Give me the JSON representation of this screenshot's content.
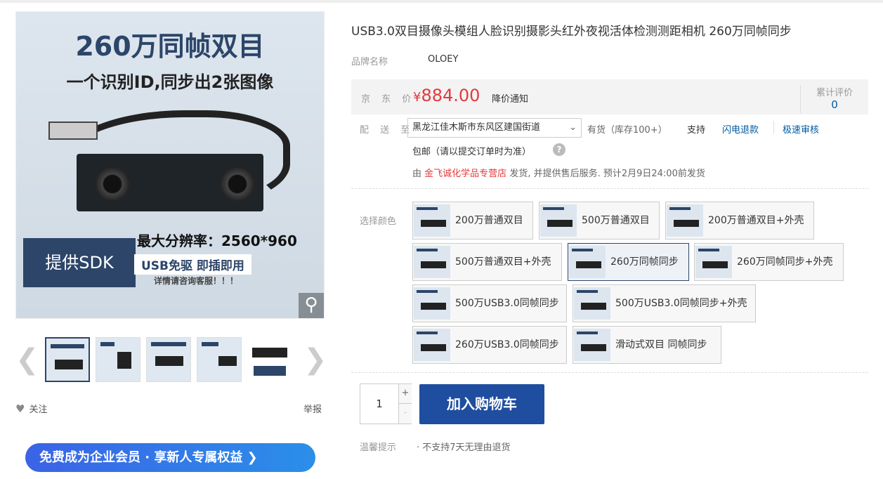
{
  "gallery": {
    "main_image": {
      "headline": "260万同帧双目",
      "subline": "一个识别ID,同步出2张图像",
      "spec": "最大分辨率：2560*960",
      "sdk": "提供SDK",
      "usb": "USB免驱 即插即用",
      "consult": "详情请咨询客服！！！"
    },
    "follow_label": "关注",
    "report_label": "举报"
  },
  "banner": {
    "text": "免费成为企业会员 · 享新人专属权益"
  },
  "product": {
    "title": "USB3.0双目摄像头模组人脸识别摄影头红外夜视活体检测测距相机 260万同帧同步",
    "brand_label": "品牌名称",
    "brand_value": "OLOEY"
  },
  "price": {
    "label": "京 东 价",
    "symbol": "¥",
    "amount": "884.00",
    "notice": "降价通知",
    "review_label": "累计评价",
    "review_count": "0"
  },
  "delivery": {
    "label": "配 送 至",
    "address": "黑龙江佳木斯市东风区建国街道",
    "stock": "有货（库存100+）",
    "support": "支持",
    "service1": "闪电退款",
    "service2": "极速审核",
    "freeship": "包邮（请以提交订单时为准）",
    "ship_prefix": "由",
    "shop": "金飞诚化学品专营店",
    "ship_suffix": "发货, 并提供售后服务. 预计2月9日24:00前发货"
  },
  "colors": {
    "label": "选择颜色",
    "options": [
      "200万普通双目",
      "500万普通双目",
      "200万普通双目+外壳",
      "500万普通双目+外壳",
      "260万同帧同步",
      "260万同帧同步+外壳",
      "500万USB3.0同帧同步",
      "500万USB3.0同帧同步+外壳",
      "260万USB3.0同帧同步",
      "滑动式双目 同帧同步"
    ],
    "selected": "260万同帧同步"
  },
  "purchase": {
    "quantity": "1",
    "plus": "+",
    "minus": "-",
    "cart_label": "加入购物车"
  },
  "tips": {
    "label": "温馨提示",
    "value": "· 不支持7天无理由退货"
  },
  "colors_theme": {
    "accent": "#1f4da0",
    "price": "#e4393c",
    "link": "#005aa0"
  }
}
